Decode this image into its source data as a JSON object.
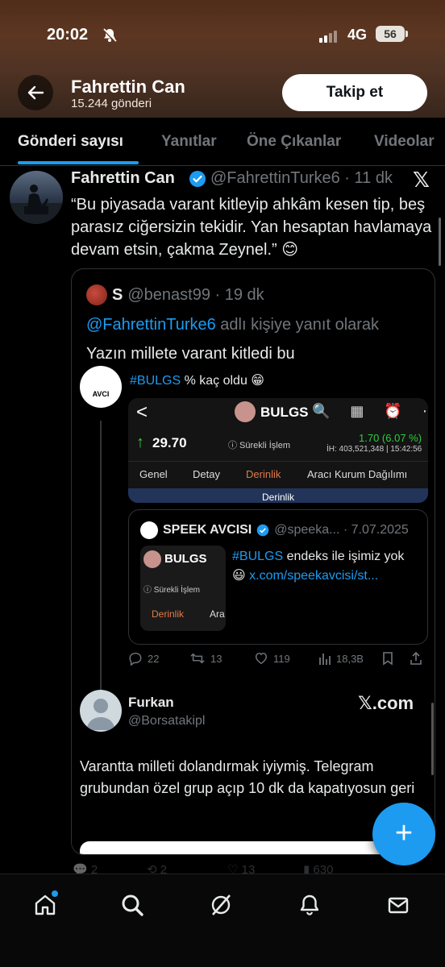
{
  "status_bar": {
    "time": "20:02",
    "network": "4G",
    "battery": "56"
  },
  "header": {
    "name": "Fahrettin Can",
    "post_count": "15.244 gönderi",
    "follow_label": "Takip et"
  },
  "tabs": [
    {
      "label": "Gönderi sayısı",
      "active": true
    },
    {
      "label": "Yanıtlar",
      "active": false
    },
    {
      "label": "Öne Çıkanlar",
      "active": false
    },
    {
      "label": "Videolar",
      "active": false
    }
  ],
  "tweet": {
    "name": "Fahrettin Can",
    "handle": "@FahrettinTurke6 · 11 dk",
    "text": "“Bu piyasada varant kitleyip ahkâm kesen tip, beş parasız ciğersizin tekidir. Yan hesaptan havlamaya devam etsin, çakma Zeynel.” 😊",
    "quote": {
      "name": "S",
      "handle": "@benast99 · 19 dk",
      "reply_mention": "@FahrettinTurke6",
      "reply_suffix": " adlı kişiye yanıt olarak",
      "text": "Yazın millete varant kitledi bu",
      "embed": {
        "avatar_label": "AVCI",
        "hashtag": "#BULGS",
        "line_rest": " % kaç oldu 😁",
        "app": {
          "back": "<",
          "title": "BULGS",
          "icons": "🔍 ▦ ⏰ ⋯",
          "arrow": "↑",
          "price": "29.70",
          "status": "ⓘ Sürekli İşlem",
          "change": "1.70 (6.07 %)",
          "volume": "İH:  403,521,348 | 15:42:56",
          "tabs": [
            {
              "label": "Genel",
              "active": false
            },
            {
              "label": "Detay",
              "active": false
            },
            {
              "label": "Derinlik",
              "active": true
            },
            {
              "label": "Aracı Kurum Dağılımı",
              "active": false
            }
          ],
          "band": "Derinlik"
        },
        "inner_quote": {
          "name": "SPEEK AVCISI",
          "handle": "@speeka... · 7.07.2025",
          "thumb_title": "BULGS",
          "thumb_status": "ⓘ Sürekli İşlem",
          "thumb_tab": "Derinlik",
          "thumb_tab_next": "Ara",
          "hashtag": "#BULGS",
          "text_mid": " endeks ile işimiz yok 😃 ",
          "link": "x.com/speekavcisi/st..."
        },
        "actions": {
          "replies": "22",
          "reposts": "13",
          "likes": "119",
          "views": "18,3B"
        },
        "reply": {
          "name": "Furkan",
          "handle": "@Borsatakipl",
          "brand": "𝕏.com",
          "text": "Varantta milleti dolandırmak iyiymiş. Telegram grubundan özel grup açıp 10 dk da kapatıyosun geri"
        }
      }
    },
    "next_row": {
      "replies": "2",
      "reposts": "2",
      "likes": "13",
      "views": "630"
    }
  },
  "fab_label": "+",
  "colors": {
    "accent": "#1d9bf0",
    "background": "#000000",
    "muted": "#71767b",
    "text": "#e7e9ea"
  }
}
